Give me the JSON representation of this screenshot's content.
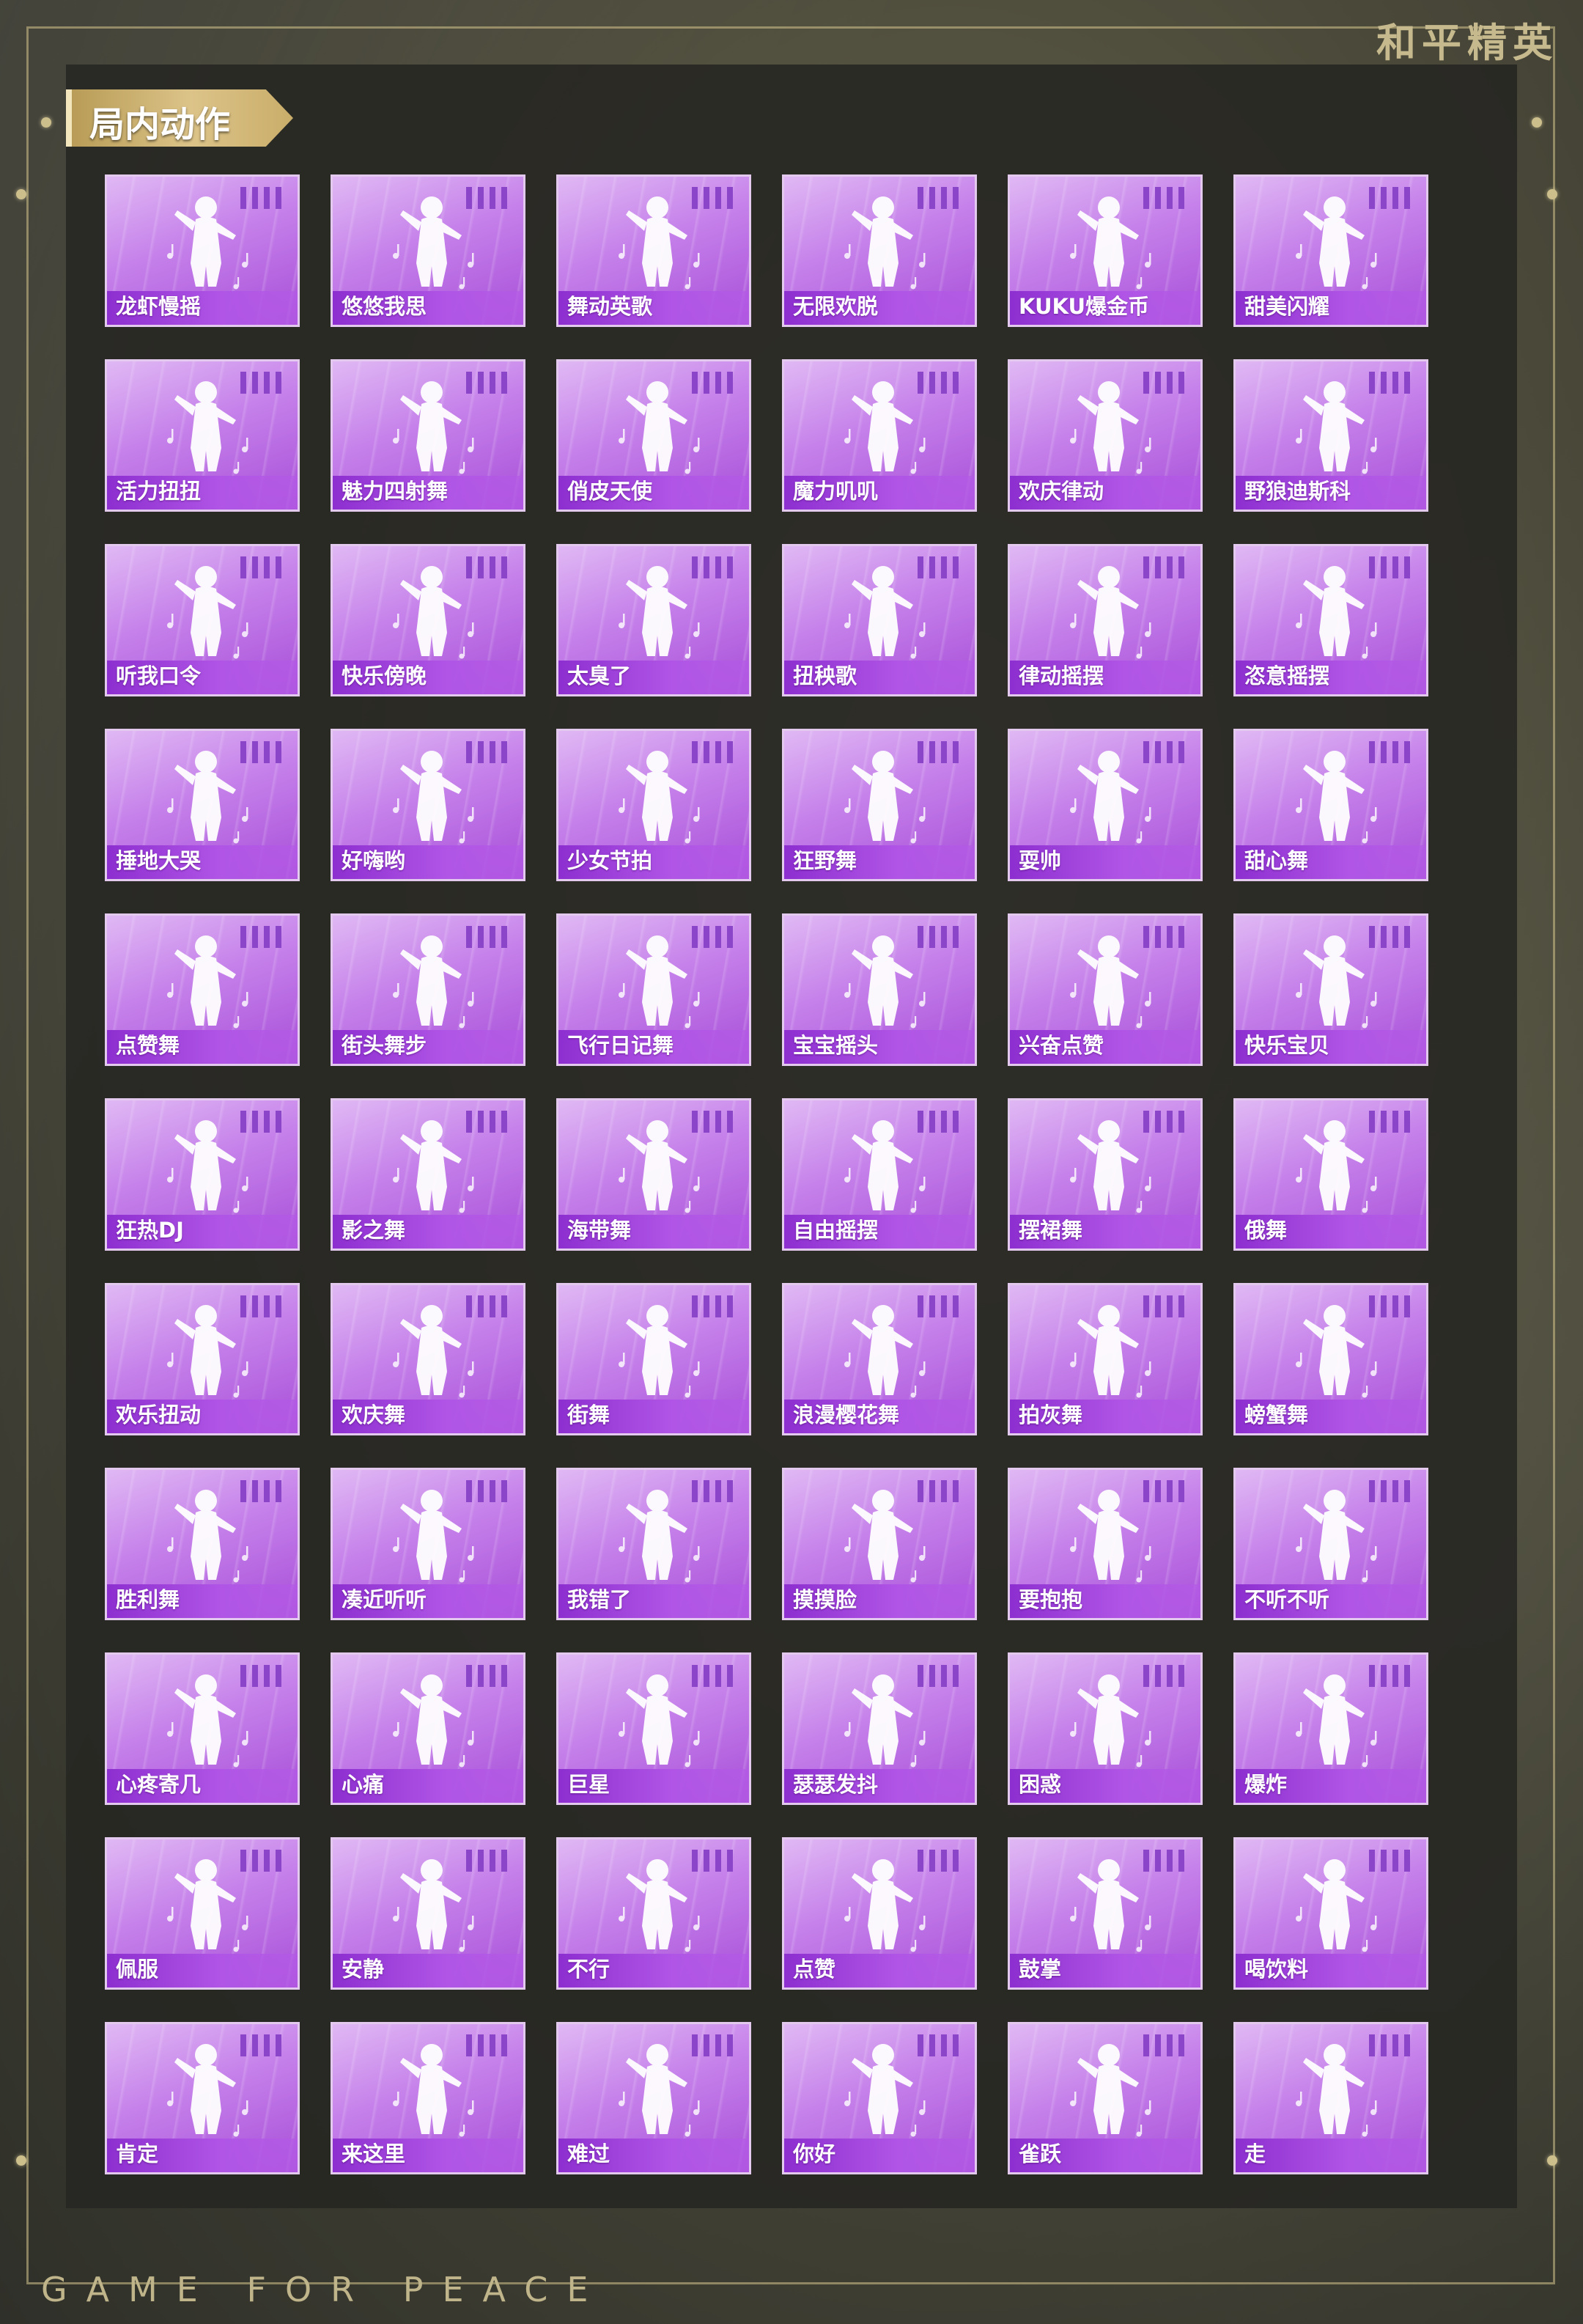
{
  "header": {
    "brand": "和平精英"
  },
  "section": {
    "title": "局内动作"
  },
  "footer": {
    "slogan": "GAME FOR PEACE"
  },
  "emotes": [
    {
      "name": "龙虾慢摇",
      "icon": "dancing-figure-icon"
    },
    {
      "name": "悠悠我思",
      "icon": "dancing-figure-icon"
    },
    {
      "name": "舞动英歌",
      "icon": "ribbon-dance-icon"
    },
    {
      "name": "无限欢脱",
      "icon": "dancing-figure-icon"
    },
    {
      "name": "KUKU爆金币",
      "icon": "money-bag-figure-icon"
    },
    {
      "name": "甜美闪耀",
      "icon": "dancing-figure-icon"
    },
    {
      "name": "活力扭扭",
      "icon": "dancing-figure-icon"
    },
    {
      "name": "魅力四射舞",
      "icon": "dancing-figure-icon"
    },
    {
      "name": "俏皮天使",
      "icon": "dancing-figure-icon"
    },
    {
      "name": "魔力叽叽",
      "icon": "dancing-figure-icon"
    },
    {
      "name": "欢庆律动",
      "icon": "dancing-figure-icon"
    },
    {
      "name": "野狼迪斯科",
      "icon": "dancing-figure-icon"
    },
    {
      "name": "听我口令",
      "icon": "lunging-figure-icon"
    },
    {
      "name": "快乐傍晚",
      "icon": "dancing-figure-icon"
    },
    {
      "name": "太臭了",
      "icon": "standing-figure-icon"
    },
    {
      "name": "扭秧歌",
      "icon": "dancing-figure-icon"
    },
    {
      "name": "律动摇摆",
      "icon": "dancing-figure-icon"
    },
    {
      "name": "恣意摇摆",
      "icon": "dancing-figure-icon"
    },
    {
      "name": "捶地大哭",
      "icon": "crawling-figure-icon"
    },
    {
      "name": "好嗨哟",
      "icon": "dancing-figure-icon"
    },
    {
      "name": "少女节拍",
      "icon": "dancing-figure-icon"
    },
    {
      "name": "狂野舞",
      "icon": "dancing-figure-icon"
    },
    {
      "name": "耍帅",
      "icon": "standing-figure-icon"
    },
    {
      "name": "甜心舞",
      "icon": "dancing-figure-icon"
    },
    {
      "name": "点赞舞",
      "icon": "dancing-figure-icon"
    },
    {
      "name": "街头舞步",
      "icon": "dancing-figure-icon"
    },
    {
      "name": "飞行日记舞",
      "icon": "dancing-figure-icon"
    },
    {
      "name": "宝宝摇头",
      "icon": "dancing-figure-icon"
    },
    {
      "name": "兴奋点赞",
      "icon": "dancing-figure-icon"
    },
    {
      "name": "快乐宝贝",
      "icon": "dancing-figure-icon"
    },
    {
      "name": "狂热DJ",
      "icon": "dj-figure-icon"
    },
    {
      "name": "影之舞",
      "icon": "dancing-figure-icon"
    },
    {
      "name": "海带舞",
      "icon": "dancing-figure-icon"
    },
    {
      "name": "自由摇摆",
      "icon": "dancing-figure-icon"
    },
    {
      "name": "摆裙舞",
      "icon": "dancing-figure-icon"
    },
    {
      "name": "俄舞",
      "icon": "dancing-figure-icon"
    },
    {
      "name": "欢乐扭动",
      "icon": "dancing-figure-icon"
    },
    {
      "name": "欢庆舞",
      "icon": "dancing-figure-icon"
    },
    {
      "name": "街舞",
      "icon": "dancing-figure-icon"
    },
    {
      "name": "浪漫樱花舞",
      "icon": "dancing-figure-icon"
    },
    {
      "name": "拍灰舞",
      "icon": "dancing-figure-icon"
    },
    {
      "name": "螃蟹舞",
      "icon": "dancing-figure-icon"
    },
    {
      "name": "胜利舞",
      "icon": "dancing-figure-icon"
    },
    {
      "name": "凑近听听",
      "icon": "standing-figure-icon"
    },
    {
      "name": "我错了",
      "icon": "standing-figure-icon"
    },
    {
      "name": "摸摸脸",
      "icon": "standing-figure-icon"
    },
    {
      "name": "要抱抱",
      "icon": "open-arms-figure-icon"
    },
    {
      "name": "不听不听",
      "icon": "standing-figure-icon"
    },
    {
      "name": "心疼寄几",
      "icon": "standing-figure-icon"
    },
    {
      "name": "心痛",
      "icon": "standing-figure-icon"
    },
    {
      "name": "巨星",
      "icon": "dancing-figure-icon"
    },
    {
      "name": "瑟瑟发抖",
      "icon": "standing-figure-icon"
    },
    {
      "name": "困惑",
      "icon": "confused-figure-icon"
    },
    {
      "name": "爆炸",
      "icon": "explode-figure-icon"
    },
    {
      "name": "佩服",
      "icon": "bowing-figure-icon"
    },
    {
      "name": "安静",
      "icon": "shush-figure-icon"
    },
    {
      "name": "不行",
      "icon": "head-shake-figure-icon"
    },
    {
      "name": "点赞",
      "icon": "thumbs-up-icon"
    },
    {
      "name": "鼓掌",
      "icon": "clapping-hands-icon"
    },
    {
      "name": "喝饮料",
      "icon": "drinking-figure-icon"
    },
    {
      "name": "肯定",
      "icon": "nodding-head-icon"
    },
    {
      "name": "来这里",
      "icon": "beckon-figure-icon"
    },
    {
      "name": "难过",
      "icon": "sad-figure-icon"
    },
    {
      "name": "你好",
      "icon": "waving-figure-icon"
    },
    {
      "name": "雀跃",
      "icon": "jumping-figure-icon"
    },
    {
      "name": "走",
      "icon": "pointing-hand-icon"
    }
  ]
}
